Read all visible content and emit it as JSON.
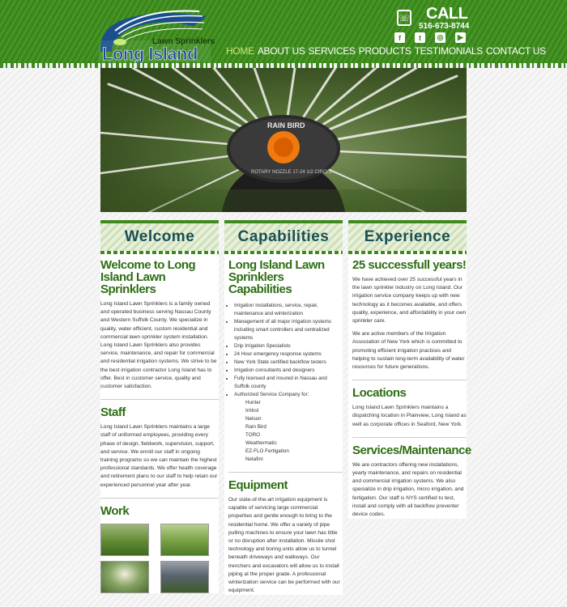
{
  "brand": {
    "logo_main": "Long Island",
    "logo_sub": "Lawn Sprinklers"
  },
  "contact": {
    "call_label": "CALL",
    "phone": "516-673-8744",
    "social": [
      "f",
      "t",
      "◎",
      "▶"
    ]
  },
  "nav": [
    "HOME",
    "ABOUT US",
    "SERVICES",
    "PRODUCTS",
    "TESTIMONIALS",
    "CONTACT US"
  ],
  "hero": {
    "nozzle_text": "RAIN BIRD",
    "nozzle_sub": "ROTARY NOZZLE 17-24 1/2 CIRCLE"
  },
  "colors": {
    "brand_green": "#3f8a1f",
    "heading_teal": "#1a4f55",
    "heading_green": "#2e6e14"
  },
  "columns": {
    "welcome": {
      "banner": "Welcome",
      "title": "Welcome to Long Island Lawn Sprinklers",
      "body": "Long Island Lawn Sprinklers is a family owned and operated business serving Nassau County and Western Suffolk County. We specialize in quality, water efficient, custom residential and commercial lawn sprinkler system installation. Long Island Lawn Sprinklers also provides service, maintenance, and repair for commercial and residential irrigation systems. We strive to be the best irrigation contractor Long Island has to offer. Best in customer service, quality and customer satisfaction.",
      "staff_title": "Staff",
      "staff_body": "Long Island Lawn Sprinklers maintains a large staff of uniformed employees, providing every phase of design, fieldwork, supervision, support, and service. We enroll our staff in ongoing training programs so we can maintain the highest professional standards. We offer health coverage and retirement plans to our staff to help retain our experienced personnel year after year.",
      "work_title": "Work"
    },
    "capabilities": {
      "banner": "Capabilities",
      "title": "Long Island Lawn Sprinklers Capabilities",
      "items": [
        "Irrigation installations, service, repair, maintenance and winterization",
        "Management of all major irrigation systems including smart controllers and centralized systems",
        "Drip Irrigation Specialists",
        "24 Hour emergency response systems",
        "New York State certified backflow testers",
        "Irrigation consultants and designers",
        "Fully licensed and insured in Nassau and Suffolk county",
        "Authorized Service Company for:"
      ],
      "brands": [
        "Hunter",
        "Irritrol",
        "Nelson",
        "Rain Bird",
        "TORO",
        "Weathermatic",
        "EZ-FLO Fertigation",
        "Netafim"
      ],
      "equipment_title": "Equipment",
      "equipment_body": "Our state-of-the-art irrigation equipment is capable of servicing large commercial properties and gentle enough to bring to the residential home. We offer a variety of pipe pulling machines to ensure your lawn has little or no disruption after installation. Missile shot technology and boring units allow us to tunnel beneath driveways and walkways. Our trenchers and excavators will allow us to install piping at the proper grade. A professional winterization service can be performed with our equipment."
    },
    "experience": {
      "banner": "Experience",
      "title": "25 successfull years!",
      "body1": "We have achieved over 25 successful years in the lawn sprinkler industry on Long Island. Our irrigation service company keeps up with new technology as it becomes available, and offers quality, experience, and affordability in your own sprinkler care.",
      "body2": "We are active members of the Irrigation Association of New York which is committed to promoting efficient irrigation practices and helping to sustain long-term availability of water resources for future generations.",
      "locations_title": "Locations",
      "locations_body": "Long Island Lawn Sprinklers maintains a dispatching location in Plainview, Long Island as well as corporate offices in Seaford, New York.",
      "services_title": "Services/Maintenance",
      "services_body": "We are contractors offering new installations, yearly maintenance, and repairs on residential and commercial irrigation systems. We also specialize in drip irrigation, micro irrigation, and fertigation. Our staff is NYS certified to test, install and comply with all backflow preventer device codes."
    }
  }
}
